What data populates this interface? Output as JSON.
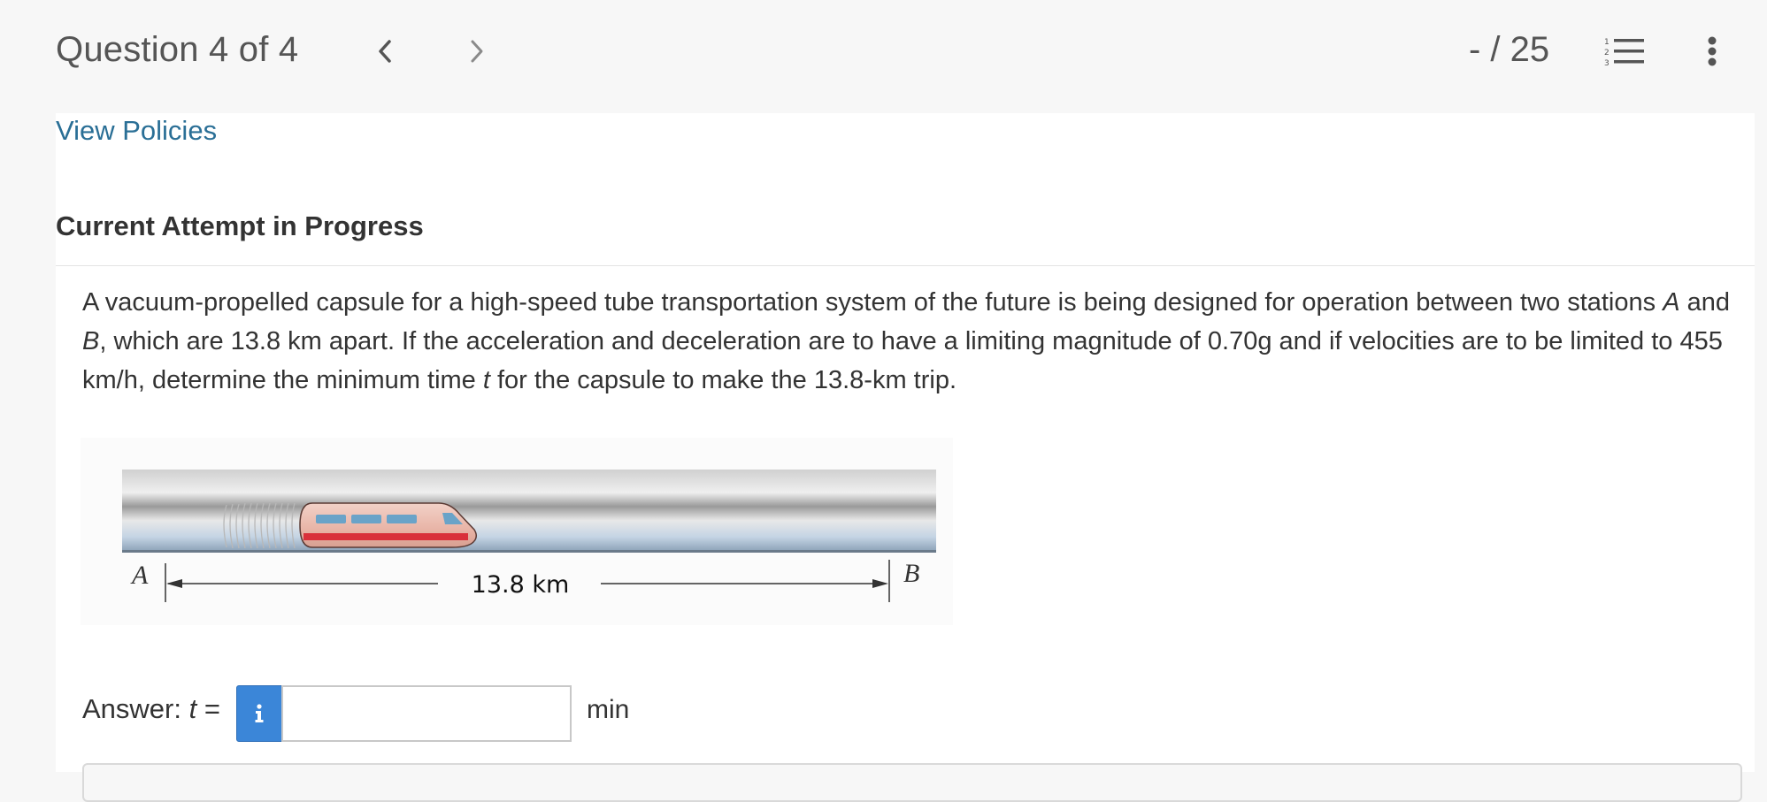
{
  "header": {
    "question_counter": "Question 4 of 4",
    "score": "- / 25"
  },
  "icons": {
    "prev": "chevron-left-icon",
    "next": "chevron-right-icon",
    "list": "numbered-list-icon",
    "more": "vertical-ellipsis-icon",
    "info": "info-icon"
  },
  "links": {
    "view_policies": "View Policies"
  },
  "section": {
    "attempt_heading": "Current Attempt in Progress"
  },
  "question": {
    "part1": "A vacuum-propelled capsule for a high-speed tube transportation system of the future is being designed for operation between two stations ",
    "station_a": "A",
    "part2": " and ",
    "station_b": "B",
    "part3": ", which are 13.8 km apart. If the acceleration and deceleration are to have a limiting magnitude of 0.70g and if velocities are to be limited to 455 km/h, determine the minimum time ",
    "var_t": "t",
    "part4": " for the capsule to make the 13.8-km trip."
  },
  "figure": {
    "label_a": "A",
    "label_b": "B",
    "distance": "13.8 km"
  },
  "answer": {
    "label_prefix": "Answer: ",
    "label_var": "t",
    "label_suffix": " =",
    "value": "",
    "unit": "min"
  },
  "colors": {
    "link": "#2a6f96",
    "info_button": "#3b86d8",
    "capsule_stripe": "#d9303a"
  }
}
